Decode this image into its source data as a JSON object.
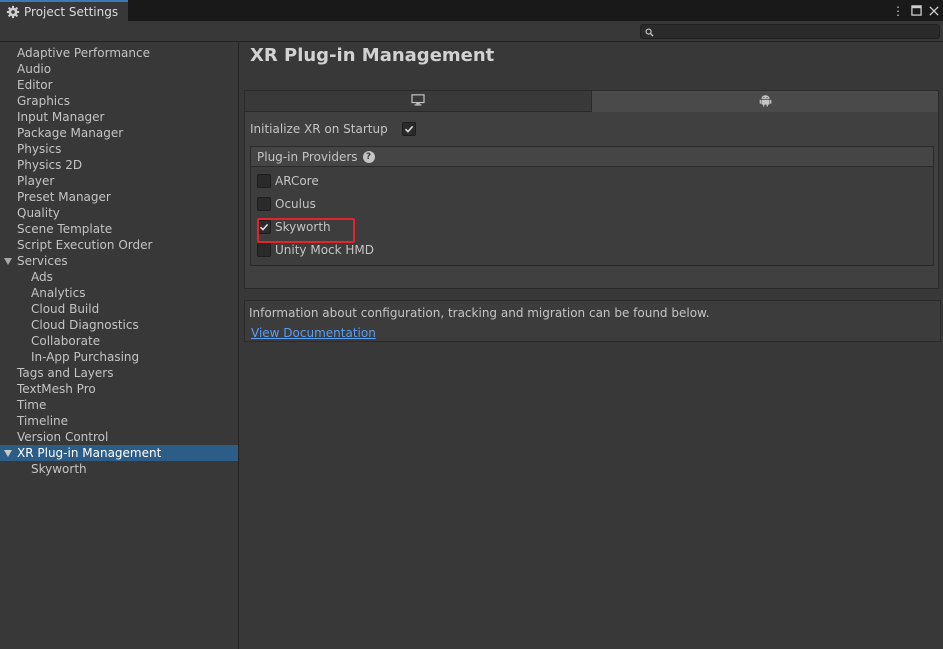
{
  "window": {
    "tab_title": "Project Settings",
    "search": {
      "placeholder": ""
    }
  },
  "sidebar": {
    "items": [
      {
        "label": "Adaptive Performance",
        "level": 0
      },
      {
        "label": "Audio",
        "level": 0
      },
      {
        "label": "Editor",
        "level": 0
      },
      {
        "label": "Graphics",
        "level": 0
      },
      {
        "label": "Input Manager",
        "level": 0
      },
      {
        "label": "Package Manager",
        "level": 0
      },
      {
        "label": "Physics",
        "level": 0
      },
      {
        "label": "Physics 2D",
        "level": 0
      },
      {
        "label": "Player",
        "level": 0
      },
      {
        "label": "Preset Manager",
        "level": 0
      },
      {
        "label": "Quality",
        "level": 0
      },
      {
        "label": "Scene Template",
        "level": 0
      },
      {
        "label": "Script Execution Order",
        "level": 0
      },
      {
        "label": "Services",
        "level": 0,
        "expanded": true
      },
      {
        "label": "Ads",
        "level": 1
      },
      {
        "label": "Analytics",
        "level": 1
      },
      {
        "label": "Cloud Build",
        "level": 1
      },
      {
        "label": "Cloud Diagnostics",
        "level": 1
      },
      {
        "label": "Collaborate",
        "level": 1
      },
      {
        "label": "In-App Purchasing",
        "level": 1
      },
      {
        "label": "Tags and Layers",
        "level": 0
      },
      {
        "label": "TextMesh Pro",
        "level": 0
      },
      {
        "label": "Time",
        "level": 0
      },
      {
        "label": "Timeline",
        "level": 0
      },
      {
        "label": "Version Control",
        "level": 0
      },
      {
        "label": "XR Plug-in Management",
        "level": 0,
        "expanded": true,
        "selected": true
      },
      {
        "label": "Skyworth",
        "level": 1
      }
    ]
  },
  "main": {
    "title": "XR Plug-in Management",
    "platform_tabs": [
      {
        "icon": "monitor-icon",
        "active": false
      },
      {
        "icon": "android-icon",
        "active": true
      }
    ],
    "init_xr": {
      "label": "Initialize XR on Startup",
      "checked": true
    },
    "providers": {
      "header": "Plug-in Providers",
      "items": [
        {
          "label": "ARCore",
          "checked": false
        },
        {
          "label": "Oculus",
          "checked": false
        },
        {
          "label": "Skyworth",
          "checked": true,
          "highlighted": true
        },
        {
          "label": "Unity Mock HMD",
          "checked": false
        }
      ]
    },
    "info": {
      "text": "Information about configuration, tracking and migration can be found below.",
      "link": "View Documentation"
    }
  },
  "colors": {
    "accent": "#2c5d87",
    "highlight": "#e0252d",
    "link": "#5b9ef0"
  }
}
